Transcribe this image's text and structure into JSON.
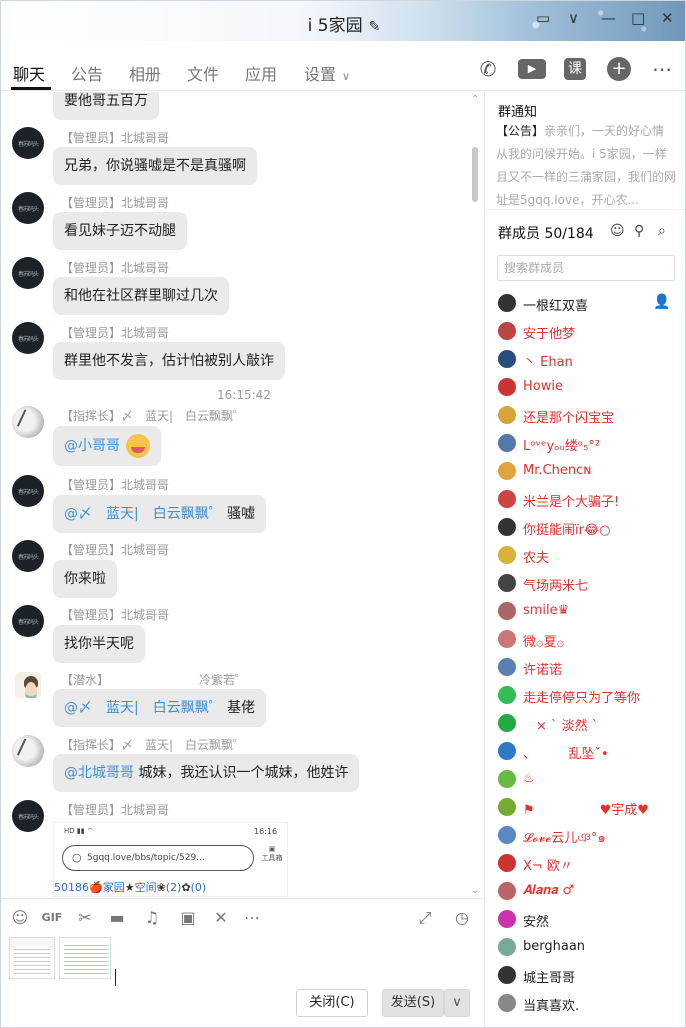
{
  "window": {
    "title": "i 5家园",
    "edit_icon": "✎",
    "controls": {
      "skin": "▭",
      "collapse": "∨",
      "minimize": "—",
      "maximize": "□",
      "close": "✕"
    }
  },
  "tabs": [
    {
      "label": "聊天"
    },
    {
      "label": "公告"
    },
    {
      "label": "相册"
    },
    {
      "label": "文件"
    },
    {
      "label": "应用"
    },
    {
      "label": "设置"
    }
  ],
  "tab_icons": {
    "call": "✆",
    "video": "▶",
    "class": "课",
    "add": "+",
    "more": "⋯"
  },
  "chat": {
    "top_bubble": "要他哥五百万",
    "time": "16:15:42",
    "messages": [
      {
        "avatar_text": "春苏码头",
        "sender": "【管理员】北城哥哥",
        "text": "兄弟，你说骚嘘是不是真骚啊"
      },
      {
        "avatar_text": "春苏码头",
        "sender": "【管理员】北城哥哥",
        "text": "看见妹子迈不动腿"
      },
      {
        "avatar_text": "春苏码头",
        "sender": "【管理员】北城哥哥",
        "text": "和他在社区群里聊过几次"
      },
      {
        "avatar_text": "春苏码头",
        "sender": "【管理员】北城哥哥",
        "text": "群里他不发言，估计怕被别人敲诈"
      },
      {
        "sender": "【指挥长】〆　蓝天|　白云飘飘゜",
        "text": "@小哥哥"
      },
      {
        "avatar_text": "春苏码头",
        "sender": "【管理员】北城哥哥",
        "mention": "@〆　蓝天|　白云飘飘゜",
        "text": "骚嘘"
      },
      {
        "avatar_text": "春苏码头",
        "sender": "【管理员】北城哥哥",
        "text": "你来啦"
      },
      {
        "avatar_text": "春苏码头",
        "sender": "【管理员】北城哥哥",
        "text": "找你半天呢"
      },
      {
        "sender": "【潜水】　　　　　　　　冷紫若゜",
        "mention": "@〆　蓝天|　白云飘飘゜",
        "text": "基佬"
      },
      {
        "sender": "【指挥长】〆　蓝天|　白云飘飘゜",
        "mention": "@北城哥哥",
        "text": "城妹，我还认识一个城妹，他姓许"
      },
      {
        "avatar_text": "春苏码头",
        "sender": "【管理员】北城哥哥"
      }
    ],
    "shared_image": {
      "status": "HD ▮▮ ⌔",
      "clock": "16:16",
      "url": "5gqq.love/bbs/topic/529...",
      "tool_label": "工具箱",
      "footer": "50186",
      "footer_home": "家园",
      "footer_space": "空间",
      "footer_count": "(2)",
      "footer_zero": "(0)"
    }
  },
  "toolbar": {
    "icons": {
      "emoji": "☺",
      "gif": "GIF",
      "scissors": "✂",
      "folder": "▬",
      "music": "♫",
      "image": "▣",
      "mute": "✕",
      "more": "⋯",
      "expand": "⤢",
      "history": "◷"
    }
  },
  "buttons": {
    "close": "关闭(C)",
    "send": "发送(S)",
    "dropdown": "∨"
  },
  "right_panel": {
    "notice_title": "群通知",
    "notice_label": "【公告】",
    "notice_text": "亲亲们，一天的好心情从我的问候开始。i 5家园，一样且又不一样的三蒲家园，我们的网址是5gqq.love，开心农...",
    "members_title": "群成员 50/184",
    "search_placeholder": "搜索群成员",
    "members": [
      {
        "name": "一根红双喜",
        "color": "#222222",
        "role": true
      },
      {
        "name": "安于他梦",
        "color": "#e53030"
      },
      {
        "name": "丶 Ehan",
        "color": "#e53030"
      },
      {
        "name": "Howie",
        "color": "#e53030"
      },
      {
        "name": "还是那个闪宝宝",
        "color": "#e53030"
      },
      {
        "name": "Lᵒᵛᵉyₒᵤ缕ᵒ₅°²",
        "color": "#e53030"
      },
      {
        "name": "Mr.Chenᴄɴ",
        "color": "#e53030"
      },
      {
        "name": "米兰是个大骗子!",
        "color": "#e53030"
      },
      {
        "name": "你挺能闹ïr😂○",
        "color": "#e53030"
      },
      {
        "name": "农夫",
        "color": "#e53030"
      },
      {
        "name": "气场两米七",
        "color": "#e53030"
      },
      {
        "name": "smile♛",
        "color": "#e53030"
      },
      {
        "name": "微۞夏۞",
        "color": "#e53030"
      },
      {
        "name": "许诺诺",
        "color": "#e53030"
      },
      {
        "name": "走走停停只为了等你",
        "color": "#e53030"
      },
      {
        "name": "　× ` 淡然 `",
        "color": "#e53030"
      },
      {
        "name": "、　　　乱坠ˇ•",
        "color": "#e53030"
      },
      {
        "name": "♨",
        "color": "#e53030"
      },
      {
        "name": "⚑　　　　　♥宇成♥",
        "color": "#e53030"
      },
      {
        "name": "𝓛𝓸𝓿𝓮云儿ঞ°๑",
        "color": "#e53030"
      },
      {
        "name": "X¬ 欧〃",
        "color": "#e53030"
      },
      {
        "name": "𝑨𝒍𝒂𝒏𝒂 ♂",
        "color": "#e53030"
      },
      {
        "name": "安然",
        "color": "#222222"
      },
      {
        "name": "berghaan",
        "color": "#222222"
      },
      {
        "name": "城主哥哥",
        "color": "#222222"
      },
      {
        "name": "当真喜欢.",
        "color": "#222222"
      }
    ]
  }
}
